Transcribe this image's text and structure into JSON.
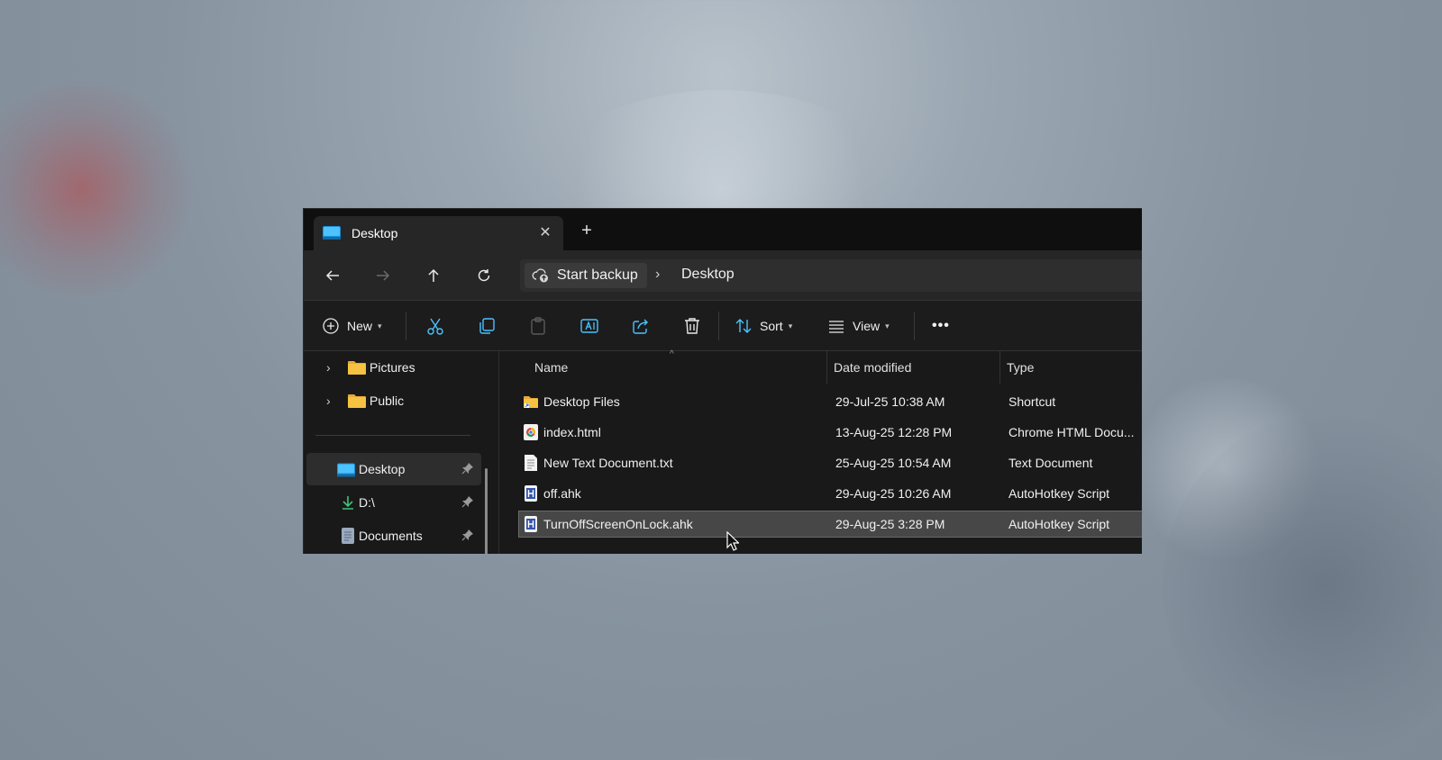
{
  "window": {
    "tab": {
      "title": "Desktop",
      "close_icon": "close-icon",
      "new_tab_icon": "plus-icon"
    }
  },
  "navigation": {
    "back_icon": "arrow-left-icon",
    "forward_icon": "arrow-right-icon",
    "up_icon": "arrow-up-icon",
    "refresh_icon": "refresh-icon",
    "breadcrumb": {
      "backup_label": "Start backup",
      "separator": "›",
      "current": "Desktop"
    }
  },
  "toolbar": {
    "new_label": "New",
    "sort_label": "Sort",
    "view_label": "View",
    "more_label": "•••",
    "icons": [
      "plus-circle-icon",
      "cut-icon",
      "copy-icon",
      "paste-icon",
      "rename-icon",
      "share-icon",
      "delete-icon",
      "sort-icon",
      "view-icon",
      "more-icon"
    ]
  },
  "sidebar": {
    "tree_items": [
      {
        "label": "Pictures",
        "icon": "folder-icon"
      },
      {
        "label": "Public",
        "icon": "folder-icon"
      }
    ],
    "quick_access": [
      {
        "label": "Desktop",
        "icon": "desktop-icon",
        "pinned": true,
        "active": true
      },
      {
        "label": "D:\\",
        "icon": "download-icon",
        "pinned": true
      },
      {
        "label": "Documents",
        "icon": "document-icon",
        "pinned": true
      }
    ]
  },
  "file_list": {
    "columns": [
      "Name",
      "Date modified",
      "Type"
    ],
    "sort_indicator": "^",
    "rows": [
      {
        "name": "Desktop Files",
        "date": "29-Jul-25 10:38 AM",
        "type": "Shortcut",
        "icon": "folder-shortcut-icon"
      },
      {
        "name": "index.html",
        "date": "13-Aug-25 12:28 PM",
        "type": "Chrome HTML Docu...",
        "icon": "chrome-icon"
      },
      {
        "name": "New Text Document.txt",
        "date": "25-Aug-25 10:54 AM",
        "type": "Text Document",
        "icon": "text-file-icon"
      },
      {
        "name": "off.ahk",
        "date": "29-Aug-25 10:26 AM",
        "type": "AutoHotkey Script",
        "icon": "ahk-icon"
      },
      {
        "name": "TurnOffScreenOnLock.ahk",
        "date": "29-Aug-25 3:28 PM",
        "type": "AutoHotkey Script",
        "icon": "ahk-icon",
        "selected": true
      }
    ]
  },
  "colors": {
    "window_bg": "#191919",
    "accent_blue": "#4cc2ff",
    "folder_yellow": "#f5c242",
    "selected_row": "#474747"
  }
}
